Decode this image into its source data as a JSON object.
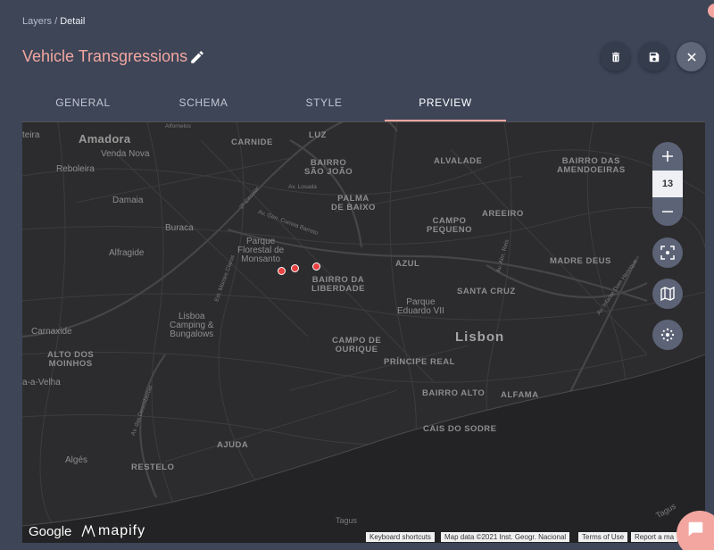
{
  "breadcrumb": {
    "parent": "Layers",
    "separator": " / ",
    "current": "Detail"
  },
  "header": {
    "title": "Vehicle Transgressions",
    "title_color": "#f3a6a0",
    "actions": [
      "trash-icon",
      "save-icon",
      "close-icon"
    ]
  },
  "tabs": [
    {
      "label": "GENERAL",
      "active": false
    },
    {
      "label": "SCHEMA",
      "active": false
    },
    {
      "label": "STYLE",
      "active": false
    },
    {
      "label": "PREVIEW",
      "active": true
    }
  ],
  "map": {
    "zoom_level": "13",
    "marker_color": "#e84040",
    "places": {
      "amadora": "Amadora",
      "venda_nova": "Venda Nova",
      "reboleira": "Reboleira",
      "damaia": "Damaia",
      "buraca": "Buraca",
      "alfragide": "Alfragide",
      "carnaxide": "Carnaxide",
      "alto_dos_moinhos": "ALTO DOS\nMOINHOS",
      "cruz_quebrada": "a-a-Velha",
      "alges": "Algés",
      "restelo": "RESTELO",
      "ajuda": "AJUDA",
      "lisboa_camping": "Lisboa\nCamping &\nBungalows",
      "parque_florestal": "Parque\nFlorestal de\nMonsanto",
      "carnide": "CARNIDE",
      "luz": "LUZ",
      "bairro_sao_joao": "BAIRRO\nSÃO JOÃO",
      "palma_de_baixo": "PALMA\nDE BAIXO",
      "alvalade": "ALVALADE",
      "bairro_amendoeiras": "BAIRRO DAS\nAMENDOEIRAS",
      "campo_pequeno": "CAMPO\nPEQUENO",
      "areeiro": "AREEIRO",
      "azul": "AZUL",
      "madre_deus": "MADRE DEUS",
      "bairro_liberdade": "BAIRRO DA\nLIBERDADE",
      "santa_cruz": "SANTA CRUZ",
      "parque_eduardo": "Parque\nEduardo VII",
      "lisbon": "Lisbon",
      "campo_de_ourique": "CAMPO DE\nOURIQUE",
      "principe_real": "PRÍNCIPE REAL",
      "bairro_alto": "BAIRRO ALTO",
      "alfama": "ALFAMA",
      "cais_do_sodre": "CAIS DO SODRE",
      "tagus": "Tagus",
      "tagus2": "Tagus",
      "alfornelos": "Alfornelos",
      "teira": "teira"
    },
    "roads": {
      "losada": "Av. Losada",
      "gen_correia": "Av. Gen. Correia Barreto",
      "circular": "2ª Circular",
      "descobertas": "Av. das Descobertas",
      "montes_claros": "Est. Montes Claros",
      "infante": "Av. Infante Dom Henrique",
      "almirante": "Av. Alm. Reis"
    },
    "attribution": {
      "shortcuts": "Keyboard shortcuts",
      "data": "Map data ©2021 Inst. Geogr. Nacional",
      "terms": "Terms of Use",
      "report": "Report a ma"
    },
    "logos": {
      "google": "Google",
      "mapify": "mapify"
    }
  }
}
